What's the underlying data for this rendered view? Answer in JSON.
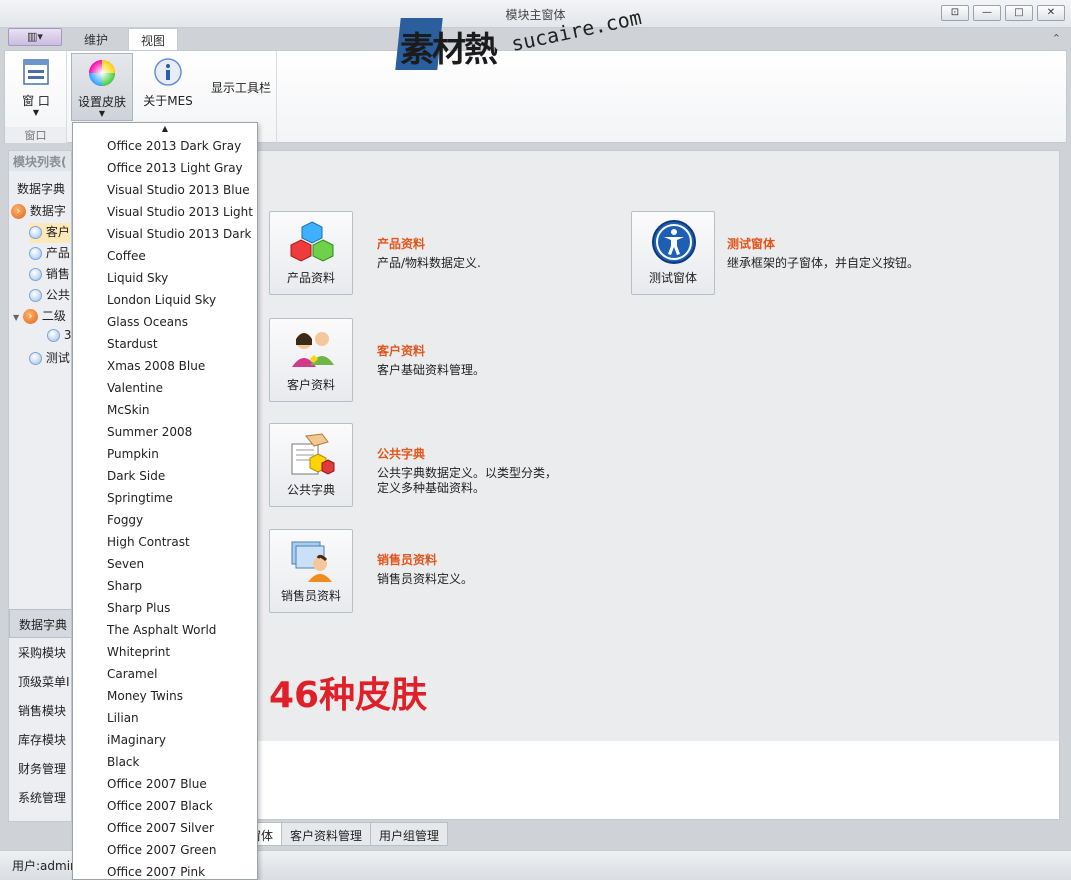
{
  "window": {
    "title": "模块主窗体",
    "buttons": [
      "⊡",
      "—",
      "□",
      "✕"
    ]
  },
  "ribbon": {
    "app_menu": "▥▾",
    "tabs": [
      "维护",
      "视图"
    ],
    "collapse": "⌃",
    "groups": {
      "window": {
        "button": "窗 口",
        "label": "窗口"
      },
      "skin_button": "设置皮肤",
      "about_button": "关于MES",
      "toolbar_button": "显示工具栏"
    }
  },
  "left_panel": {
    "header": "模块列表(",
    "top_item": "数据字典",
    "tree": [
      "数据字",
      "客户",
      "产品",
      "销售",
      "公共",
      "二级",
      "3",
      "测试"
    ],
    "nav": [
      "数据字典",
      "采购模块",
      "顶级菜单I",
      "销售模块",
      "库存模块",
      "财务管理",
      "系统管理"
    ]
  },
  "modules": [
    {
      "name": "产品资料",
      "title": "产品资料",
      "desc": "产品/物料数据定义.",
      "icon": "cubes-icon"
    },
    {
      "name": "客户资料",
      "title": "客户资料",
      "desc": "客户基础资料管理。",
      "icon": "customers-icon"
    },
    {
      "name": "公共字典",
      "title": "公共字典",
      "desc": "公共字典数据定义。以类型分类，",
      "desc2": "定义多种基础资料。",
      "icon": "dictionary-icon"
    },
    {
      "name": "销售员资料",
      "title": "销售员资料",
      "desc": "销售员资料定义。",
      "icon": "salesman-icon"
    },
    {
      "name": "测试窗体",
      "title": "测试窗体",
      "desc": "继承框架的子窗体，并自定义按钮。",
      "icon": "accessibility-icon"
    }
  ],
  "big_label": "46种皮肤",
  "doc_tabs": [
    "窗体",
    "客户资料管理",
    "用户组管理"
  ],
  "status": {
    "user": "用户:admin"
  },
  "watermark": {
    "logo": "素材熱",
    "url": "sucaire.com"
  },
  "skins": [
    "Office 2013 Dark Gray",
    "Office 2013 Light Gray",
    "Visual Studio 2013 Blue",
    "Visual Studio 2013 Light",
    "Visual Studio 2013 Dark",
    "Coffee",
    "Liquid Sky",
    "London Liquid Sky",
    "Glass Oceans",
    "Stardust",
    "Xmas 2008 Blue",
    "Valentine",
    "McSkin",
    "Summer 2008",
    "Pumpkin",
    "Dark Side",
    "Springtime",
    "Foggy",
    "High Contrast",
    "Seven",
    "Sharp",
    "Sharp Plus",
    "The Asphalt World",
    "Whiteprint",
    "Caramel",
    "Money Twins",
    "Lilian",
    "iMaginary",
    "Black",
    "Office 2007 Blue",
    "Office 2007 Black",
    "Office 2007 Silver",
    "Office 2007 Green",
    "Office 2007 Pink"
  ],
  "colors": {
    "accent_title": "#e0561d",
    "big_label": "#e02028"
  }
}
